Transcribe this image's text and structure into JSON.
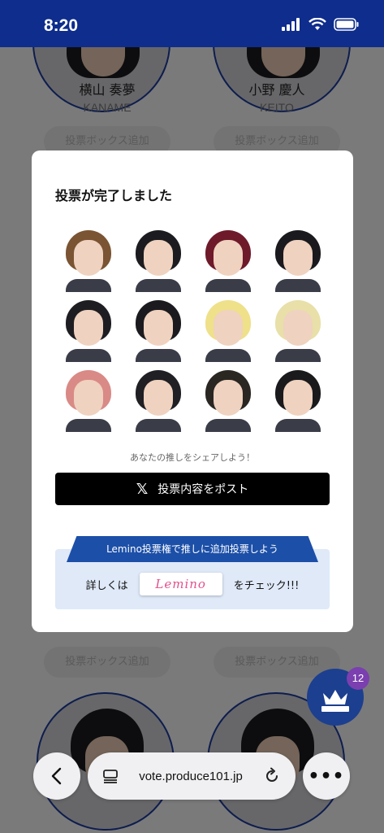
{
  "status_bar": {
    "time": "8:20",
    "icons": [
      "signal-icon",
      "wifi-icon",
      "battery-icon"
    ]
  },
  "background": {
    "cards": [
      {
        "name_jp": "横山 奏夢",
        "name_en": "KANAME"
      },
      {
        "name_jp": "小野 慶人",
        "name_en": "KEITO"
      }
    ],
    "add_box_label": "投票ボックス追加",
    "crown_badge_count": "12"
  },
  "modal": {
    "title": "投票が完了しました",
    "members": [
      {
        "hair": "#7a5433"
      },
      {
        "hair": "#1c1c20"
      },
      {
        "hair": "#6e1a2a"
      },
      {
        "hair": "#1a1a1e"
      },
      {
        "hair": "#1e1e22"
      },
      {
        "hair": "#1b1b1f"
      },
      {
        "hair": "#efe08a"
      },
      {
        "hair": "#e8e0a8"
      },
      {
        "hair": "#d98a86"
      },
      {
        "hair": "#1f1f24"
      },
      {
        "hair": "#2a2622"
      },
      {
        "hair": "#1a1a1d"
      }
    ],
    "share_caption": "あなたの推しをシェアしよう！",
    "post_button": "投票内容をポスト",
    "x_icon": "𝕏",
    "lemino_banner": "Lemino投票権で推しに追加投票しよう",
    "lemino_prefix": "詳しくは",
    "lemino_logo": "Lemino",
    "lemino_suffix": "をチェック!!!"
  },
  "browser": {
    "url": "vote.produce101.jp"
  },
  "colors": {
    "status_bar": "#0e2d8c",
    "banner": "#1c4fa8",
    "lemino_pink": "#e2508c"
  }
}
